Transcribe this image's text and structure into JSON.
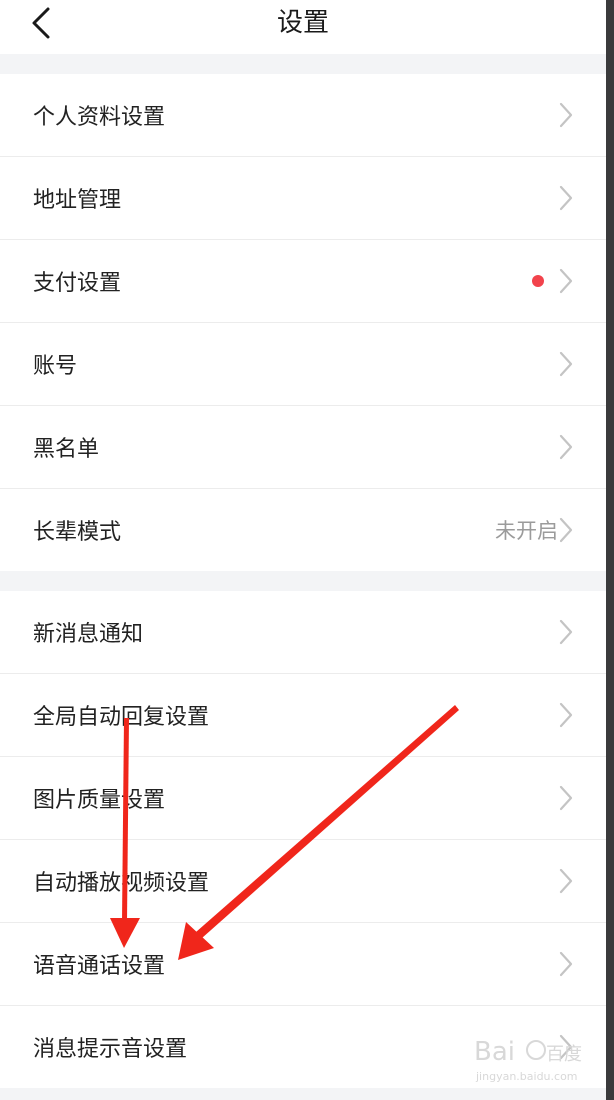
{
  "header": {
    "title": "设置"
  },
  "group1": {
    "items": [
      {
        "label": "个人资料设置"
      },
      {
        "label": "地址管理"
      },
      {
        "label": "支付设置"
      },
      {
        "label": "账号"
      },
      {
        "label": "黑名单"
      },
      {
        "label": "长辈模式",
        "value": "未开启"
      }
    ]
  },
  "group2": {
    "items": [
      {
        "label": "新消息通知"
      },
      {
        "label": "全局自动回复设置"
      },
      {
        "label": "图片质量设置"
      },
      {
        "label": "自动播放视频设置"
      },
      {
        "label": "语音通话设置"
      },
      {
        "label": "消息提示音设置"
      }
    ]
  },
  "watermark": {
    "brand": "Bai",
    "brand2": "百度",
    "site": "jingyan.baidu.com"
  },
  "colors": {
    "accent_red": "#f2434c",
    "annotation_red": "#f0261b"
  }
}
